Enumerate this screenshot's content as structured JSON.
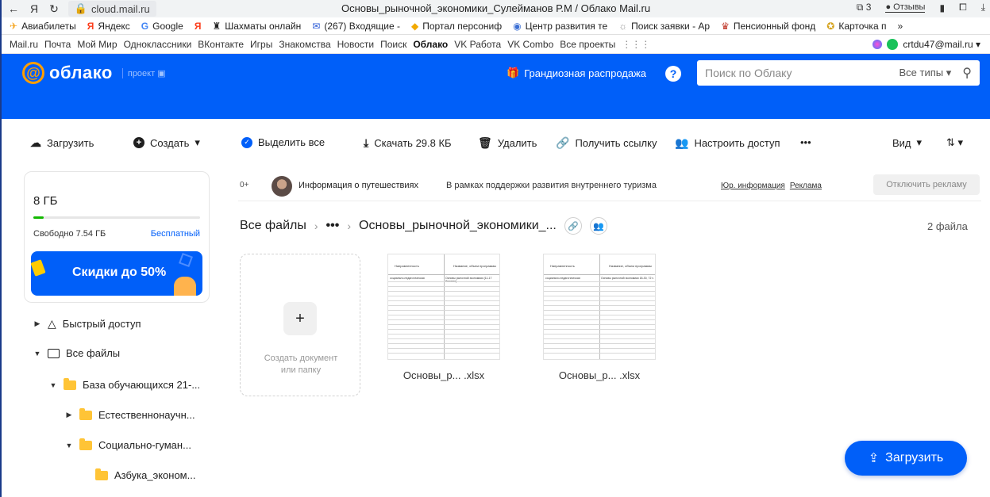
{
  "browser": {
    "back": "←",
    "yandex": "Я",
    "reload": "↻",
    "address": "cloud.mail.ru",
    "title": "Основы_рыночной_экономики_Сулейманов Р.М / Облако Mail.ru",
    "tabs_count": "3",
    "feedback": "Отзывы"
  },
  "bookmarks": [
    {
      "label": "Авиабилеты"
    },
    {
      "label": "Яндекс"
    },
    {
      "label": "Google"
    },
    {
      "label": "Шахматы онлайн"
    },
    {
      "label": "(267) Входящие -"
    },
    {
      "label": "Портал персониф"
    },
    {
      "label": "Центр развития те"
    },
    {
      "label": "Поиск заявки - Ар"
    },
    {
      "label": "Пенсионный фонд"
    },
    {
      "label": "Карточка п"
    }
  ],
  "portal": {
    "links": [
      "Mail.ru",
      "Почта",
      "Мой Мир",
      "Одноклассники",
      "ВКонтакте",
      "Игры",
      "Знакомства",
      "Новости",
      "Поиск",
      "Облако",
      "VK Работа",
      "VK Combo",
      "Все проекты"
    ],
    "user": "crtdu47@mail.ru ▾"
  },
  "cloud_header": {
    "logo": "облако",
    "logo_sub": "проект",
    "promo": "Грандиозная распродажа",
    "search_placeholder": "Поиск по Облаку",
    "search_types": "Все типы",
    "colors": {
      "brand": "#005ff9",
      "accent": "#ff9e00"
    }
  },
  "toolbar": {
    "upload": "Загрузить",
    "create": "Создать",
    "select_all": "Выделить все",
    "download": "Скачать 29.8 КБ",
    "delete": "Удалить",
    "get_link": "Получить ссылку",
    "access": "Настроить доступ",
    "more": "•••",
    "view": "Вид"
  },
  "storage": {
    "total": "8 ГБ",
    "free": "Свободно 7.54 ГБ",
    "plan": "Бесплатный",
    "used_fraction": 0.06,
    "sale": "Скидки до 50%"
  },
  "sidebar": {
    "items": [
      {
        "label": "Быстрый доступ"
      },
      {
        "label": "Все файлы"
      },
      {
        "label": "База обучающихся 21-..."
      },
      {
        "label": "Естественнонаучн..."
      },
      {
        "label": "Социально-гуман..."
      },
      {
        "label": "Азбука_эконом..."
      }
    ]
  },
  "ad": {
    "age": "0+",
    "title": "Информация о путешествиях",
    "text": "В рамках поддержки развития внутреннего туризма",
    "legal": "Юр. информация",
    "adv": "Реклама",
    "disable": "Отключить рекламу"
  },
  "breadcrumb": {
    "root": "Все файлы",
    "dots": "•••",
    "current": "Основы_рыночной_экономики_...",
    "count": "2 файла"
  },
  "new_card": {
    "plus": "+",
    "label1": "Создать документ",
    "label2": "или папку"
  },
  "files": [
    {
      "name": "Основы_р... .xlsx",
      "col1": "Направленность",
      "col2": "Название, объем программы",
      "row1a": "социально-педагогическая",
      "row1b": "Основы рыночной экономики (11-17 базовая)"
    },
    {
      "name": "Основы_р... .xlsx",
      "col1": "Направленность",
      "col2": "Название, объем программы",
      "row1a": "социально-педагогическая",
      "row1b": "Основы рыночной экономики 18-30, 72 ч"
    }
  ],
  "fab": {
    "label": "Загрузить"
  }
}
